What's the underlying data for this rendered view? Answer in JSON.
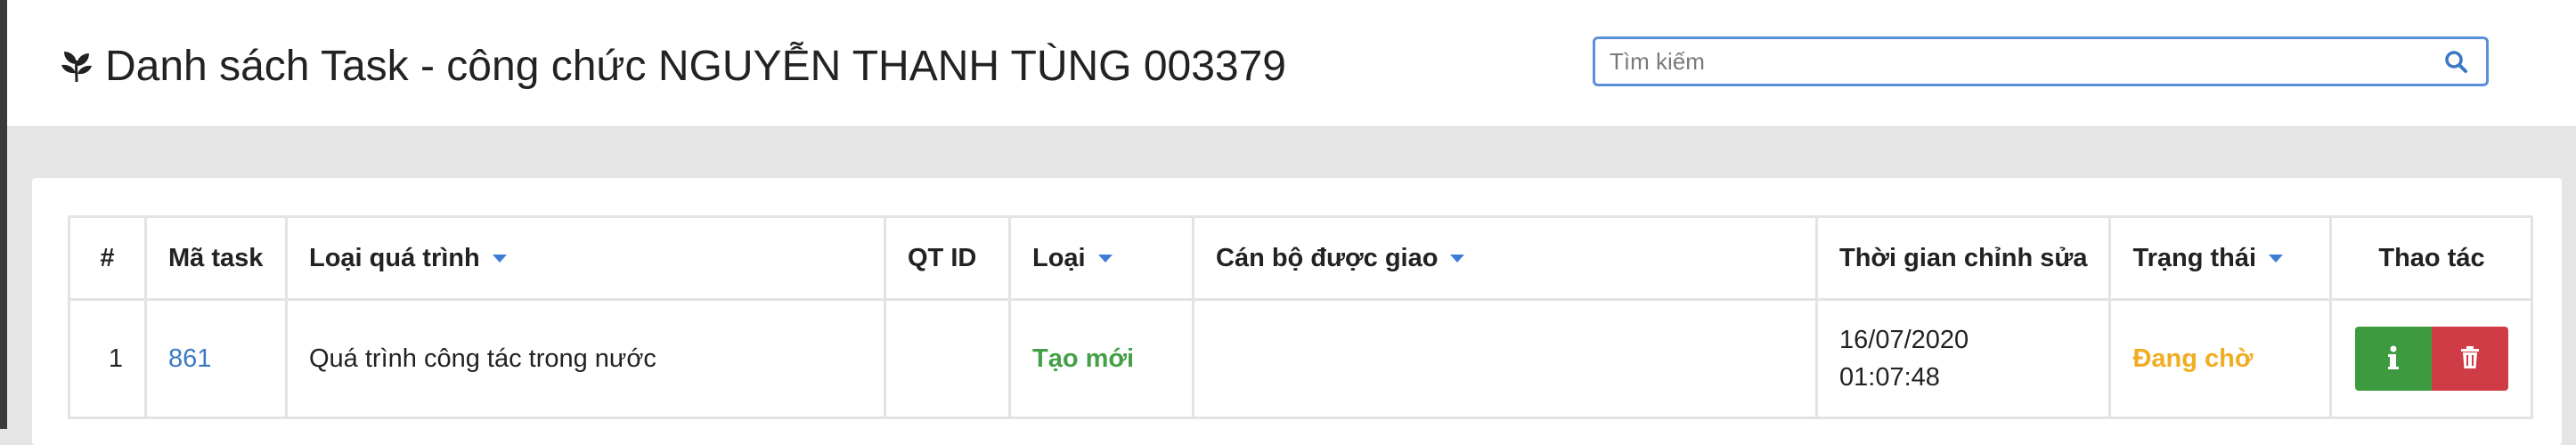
{
  "header": {
    "title": "Danh sách Task - công chức NGUYỄN THANH TÙNG 003379",
    "title_icon": "leaf-icon",
    "search": {
      "placeholder": "Tìm kiếm",
      "value": "",
      "icon": "search-icon",
      "border_color": "#5b8fd9"
    }
  },
  "table": {
    "columns": [
      {
        "label": "#",
        "sortable": false
      },
      {
        "label": "Mã task",
        "sortable": false
      },
      {
        "label": "Loại quá trình",
        "sortable": true
      },
      {
        "label": "QT ID",
        "sortable": false
      },
      {
        "label": "Loại",
        "sortable": true
      },
      {
        "label": "Cán bộ được giao",
        "sortable": true
      },
      {
        "label": "Thời gian chỉnh sửa",
        "sortable": false
      },
      {
        "label": "Trạng thái",
        "sortable": true
      },
      {
        "label": "Thao tác",
        "sortable": false
      }
    ],
    "rows": [
      {
        "index": "1",
        "task_id": "861",
        "process_type": "Quá trình công tác trong nước",
        "qt_id": "",
        "type": "Tạo mới",
        "assignee": "",
        "modified_date": "16/07/2020",
        "modified_time": "01:07:48",
        "status": "Đang chờ",
        "actions": [
          "info-icon",
          "trash-icon"
        ]
      }
    ]
  },
  "colors": {
    "link": "#3b78c4",
    "type_new": "#43a047",
    "status_pending": "#f0ad23",
    "info_button": "#3d9a3f",
    "delete_button": "#cf3c46",
    "sort_caret": "#3d7dd8"
  }
}
